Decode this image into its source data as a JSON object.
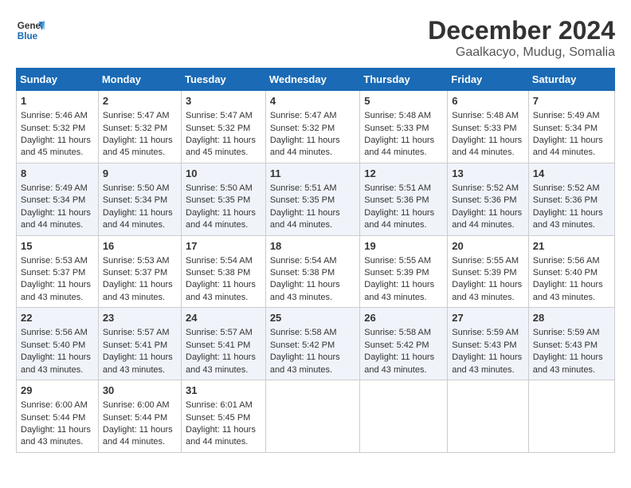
{
  "logo": {
    "line1": "General",
    "line2": "Blue"
  },
  "title": "December 2024",
  "subtitle": "Gaalkacyo, Mudug, Somalia",
  "header": {
    "accent_color": "#1a6ab5"
  },
  "weekdays": [
    "Sunday",
    "Monday",
    "Tuesday",
    "Wednesday",
    "Thursday",
    "Friday",
    "Saturday"
  ],
  "weeks": [
    [
      {
        "day": 1,
        "rise": "5:46 AM",
        "set": "5:32 PM",
        "daylight": "11 hours and 45 minutes."
      },
      {
        "day": 2,
        "rise": "5:47 AM",
        "set": "5:32 PM",
        "daylight": "11 hours and 45 minutes."
      },
      {
        "day": 3,
        "rise": "5:47 AM",
        "set": "5:32 PM",
        "daylight": "11 hours and 45 minutes."
      },
      {
        "day": 4,
        "rise": "5:47 AM",
        "set": "5:32 PM",
        "daylight": "11 hours and 44 minutes."
      },
      {
        "day": 5,
        "rise": "5:48 AM",
        "set": "5:33 PM",
        "daylight": "11 hours and 44 minutes."
      },
      {
        "day": 6,
        "rise": "5:48 AM",
        "set": "5:33 PM",
        "daylight": "11 hours and 44 minutes."
      },
      {
        "day": 7,
        "rise": "5:49 AM",
        "set": "5:34 PM",
        "daylight": "11 hours and 44 minutes."
      }
    ],
    [
      {
        "day": 8,
        "rise": "5:49 AM",
        "set": "5:34 PM",
        "daylight": "11 hours and 44 minutes."
      },
      {
        "day": 9,
        "rise": "5:50 AM",
        "set": "5:34 PM",
        "daylight": "11 hours and 44 minutes."
      },
      {
        "day": 10,
        "rise": "5:50 AM",
        "set": "5:35 PM",
        "daylight": "11 hours and 44 minutes."
      },
      {
        "day": 11,
        "rise": "5:51 AM",
        "set": "5:35 PM",
        "daylight": "11 hours and 44 minutes."
      },
      {
        "day": 12,
        "rise": "5:51 AM",
        "set": "5:36 PM",
        "daylight": "11 hours and 44 minutes."
      },
      {
        "day": 13,
        "rise": "5:52 AM",
        "set": "5:36 PM",
        "daylight": "11 hours and 44 minutes."
      },
      {
        "day": 14,
        "rise": "5:52 AM",
        "set": "5:36 PM",
        "daylight": "11 hours and 43 minutes."
      }
    ],
    [
      {
        "day": 15,
        "rise": "5:53 AM",
        "set": "5:37 PM",
        "daylight": "11 hours and 43 minutes."
      },
      {
        "day": 16,
        "rise": "5:53 AM",
        "set": "5:37 PM",
        "daylight": "11 hours and 43 minutes."
      },
      {
        "day": 17,
        "rise": "5:54 AM",
        "set": "5:38 PM",
        "daylight": "11 hours and 43 minutes."
      },
      {
        "day": 18,
        "rise": "5:54 AM",
        "set": "5:38 PM",
        "daylight": "11 hours and 43 minutes."
      },
      {
        "day": 19,
        "rise": "5:55 AM",
        "set": "5:39 PM",
        "daylight": "11 hours and 43 minutes."
      },
      {
        "day": 20,
        "rise": "5:55 AM",
        "set": "5:39 PM",
        "daylight": "11 hours and 43 minutes."
      },
      {
        "day": 21,
        "rise": "5:56 AM",
        "set": "5:40 PM",
        "daylight": "11 hours and 43 minutes."
      }
    ],
    [
      {
        "day": 22,
        "rise": "5:56 AM",
        "set": "5:40 PM",
        "daylight": "11 hours and 43 minutes."
      },
      {
        "day": 23,
        "rise": "5:57 AM",
        "set": "5:41 PM",
        "daylight": "11 hours and 43 minutes."
      },
      {
        "day": 24,
        "rise": "5:57 AM",
        "set": "5:41 PM",
        "daylight": "11 hours and 43 minutes."
      },
      {
        "day": 25,
        "rise": "5:58 AM",
        "set": "5:42 PM",
        "daylight": "11 hours and 43 minutes."
      },
      {
        "day": 26,
        "rise": "5:58 AM",
        "set": "5:42 PM",
        "daylight": "11 hours and 43 minutes."
      },
      {
        "day": 27,
        "rise": "5:59 AM",
        "set": "5:43 PM",
        "daylight": "11 hours and 43 minutes."
      },
      {
        "day": 28,
        "rise": "5:59 AM",
        "set": "5:43 PM",
        "daylight": "11 hours and 43 minutes."
      }
    ],
    [
      {
        "day": 29,
        "rise": "6:00 AM",
        "set": "5:44 PM",
        "daylight": "11 hours and 43 minutes."
      },
      {
        "day": 30,
        "rise": "6:00 AM",
        "set": "5:44 PM",
        "daylight": "11 hours and 44 minutes."
      },
      {
        "day": 31,
        "rise": "6:01 AM",
        "set": "5:45 PM",
        "daylight": "11 hours and 44 minutes."
      },
      null,
      null,
      null,
      null
    ]
  ]
}
